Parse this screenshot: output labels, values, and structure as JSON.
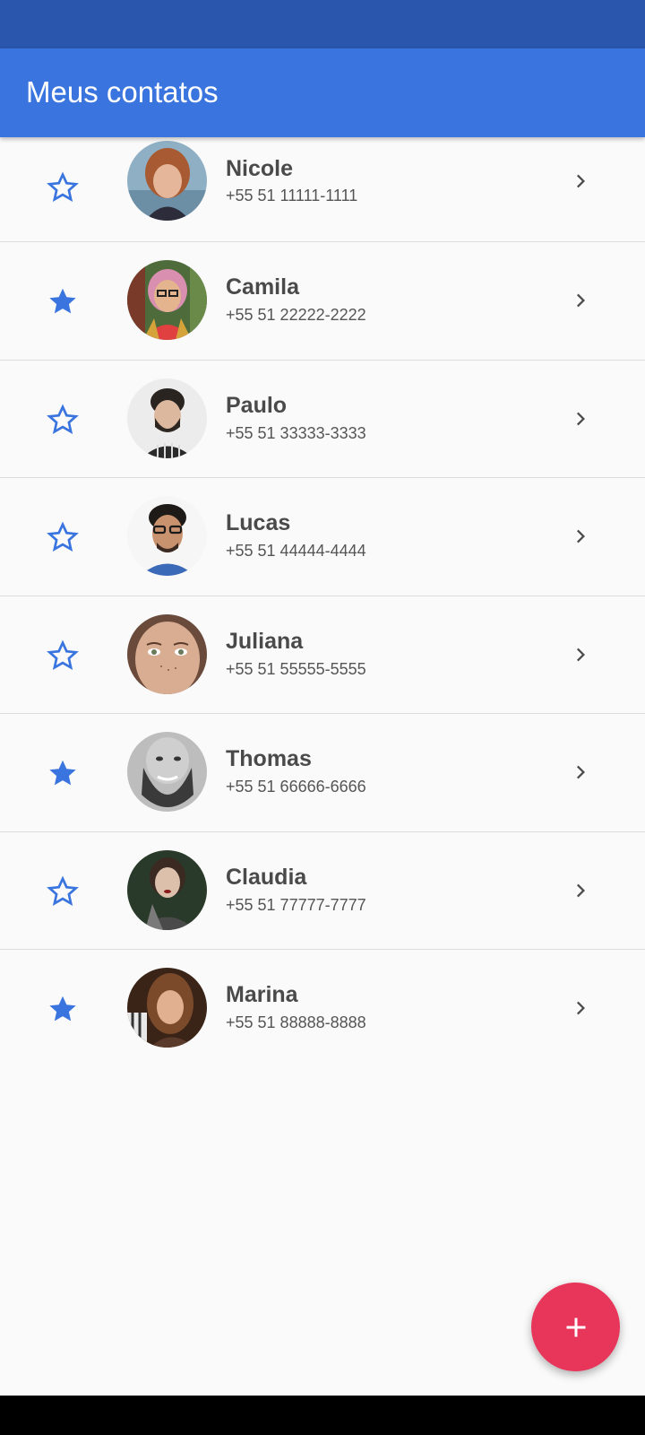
{
  "app_bar": {
    "title": "Meus contatos"
  },
  "colors": {
    "status_bar": "#2a56ae",
    "app_bar": "#3a75df",
    "star": "#3a75df",
    "fab": "#e8355a"
  },
  "contacts": [
    {
      "name": "Nicole",
      "phone": "+55 51 11111-1111",
      "favorite": false,
      "avatar": "woman-short-red-hair-photo"
    },
    {
      "name": "Camila",
      "phone": "+55 51 22222-2222",
      "favorite": true,
      "avatar": "woman-pink-hair-glasses-photo"
    },
    {
      "name": "Paulo",
      "phone": "+55 51 33333-3333",
      "favorite": false,
      "avatar": "man-beard-curly-hair-photo"
    },
    {
      "name": "Lucas",
      "phone": "+55 51 44444-4444",
      "favorite": false,
      "avatar": "man-glasses-photo"
    },
    {
      "name": "Juliana",
      "phone": "+55 51 55555-5555",
      "favorite": false,
      "avatar": "woman-freckles-photo"
    },
    {
      "name": "Thomas",
      "phone": "+55 51 66666-6666",
      "favorite": true,
      "avatar": "man-big-beard-bw-photo"
    },
    {
      "name": "Claudia",
      "phone": "+55 51 77777-7777",
      "favorite": false,
      "avatar": "woman-red-lips-photo"
    },
    {
      "name": "Marina",
      "phone": "+55 51 88888-8888",
      "favorite": true,
      "avatar": "woman-long-hair-photo"
    }
  ],
  "icons": {
    "favorite_on": "star-filled-icon",
    "favorite_off": "star-outline-icon",
    "open": "chevron-right-icon",
    "add": "plus-icon"
  }
}
